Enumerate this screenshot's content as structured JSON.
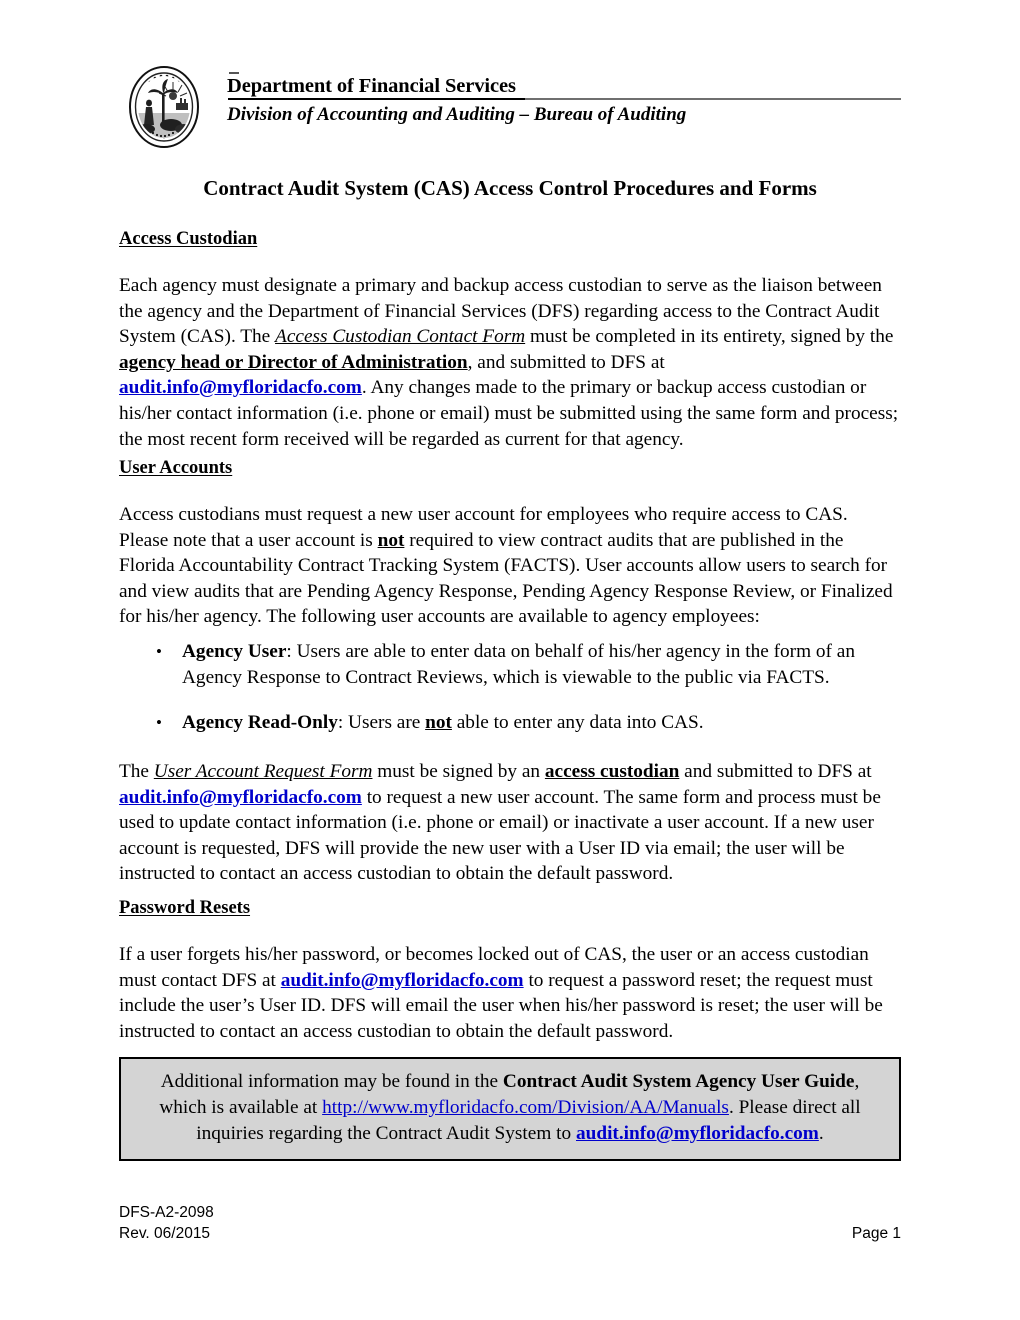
{
  "header": {
    "seal_icon": "florida-state-seal-icon",
    "department": "Department of Financial Services",
    "division": "Division of Accounting and Auditing – Bureau of Auditing"
  },
  "document": {
    "title": "Contract Audit System (CAS) Access Control Procedures and Forms"
  },
  "sections": {
    "access_custodian": {
      "heading": "Access Custodian",
      "p1": {
        "t1": "Each agency must designate a primary and backup access custodian to serve as the liaison between the agency and the Department of Financial Services (DFS) regarding access to the Contract Audit System (CAS).  The ",
        "em1": "Access Custodian Contact Form",
        "t2": " must be completed in its entirety, signed by the ",
        "em2": "agency head or Director of Administration",
        "t3": ", and submitted to DFS at ",
        "link1": "audit.info@myfloridacfo.com",
        "t4": ".  Any changes made to the primary or backup access custodian or his/her contact information (i.e. phone or email) must be submitted using the same form and process; the most recent form received will be regarded as current for that agency."
      }
    },
    "user_accounts": {
      "heading": "User Accounts",
      "p1": {
        "t1": "Access custodians must request a new user account for employees who require access to CAS.  Please note that a user account is ",
        "em1": "not",
        "t2": " required to view contract audits that are published in the Florida Accountability Contract Tracking System (FACTS).  User accounts allow users to search for and view audits that are Pending Agency Response, Pending Agency Response Review, or Finalized for his/her agency.  The following user accounts are available to agency employees:"
      },
      "bullets": [
        {
          "marker": "•",
          "label": "Agency User",
          "t1": ":  Users are able to enter data on behalf of his/her agency in the form of an Agency Response to Contract Reviews, which is viewable to the public via FACTS."
        },
        {
          "marker": "•",
          "label": "Agency Read-Only",
          "t1": ":  Users are ",
          "em1": "not",
          "t2": " able to enter any data into CAS."
        }
      ],
      "p2": {
        "t1": "The ",
        "em1": "User Account Request Form",
        "t2": " must be signed by an ",
        "em2": "access custodian",
        "t3": " and submitted to DFS at ",
        "link1": "audit.info@myfloridacfo.com",
        "t4": " to request a new user account.  The same form and process must be used to update contact information (i.e. phone or email) or inactivate a user account.  If a new user account is requested, DFS will provide the new user with a User ID via email; the user will be instructed to contact an access custodian to obtain the default password."
      }
    },
    "password_resets": {
      "heading": "Password Resets",
      "p1": {
        "t1": "If a user forgets his/her password, or becomes locked out of CAS, the user or an access custodian must contact DFS at ",
        "link1": "audit.info@myfloridacfo.com",
        "t2": " to request a password reset; the request must include the user’s User ID.  DFS will email the user when his/her password is reset; the user will be instructed to contact an access custodian to obtain the default password."
      }
    }
  },
  "callout": {
    "t1": "Additional information may be found in the ",
    "em1": "Contract Audit System Agency User Guide",
    "t2": ", which is available at ",
    "link1": "http://www.myfloridacfo.com/Division/AA/Manuals",
    "t3": ".  Please direct all inquiries regarding the Contract Audit System to ",
    "link2": "audit.info@myfloridacfo.com",
    "t4": "."
  },
  "footer": {
    "form_number": "DFS-A2-2098",
    "revision": "Rev. 06/2015",
    "page": "Page 1"
  },
  "colors": {
    "link": "#0000cc",
    "callout_bg": "#d4d4d4",
    "rule": "#6f6f6f"
  }
}
